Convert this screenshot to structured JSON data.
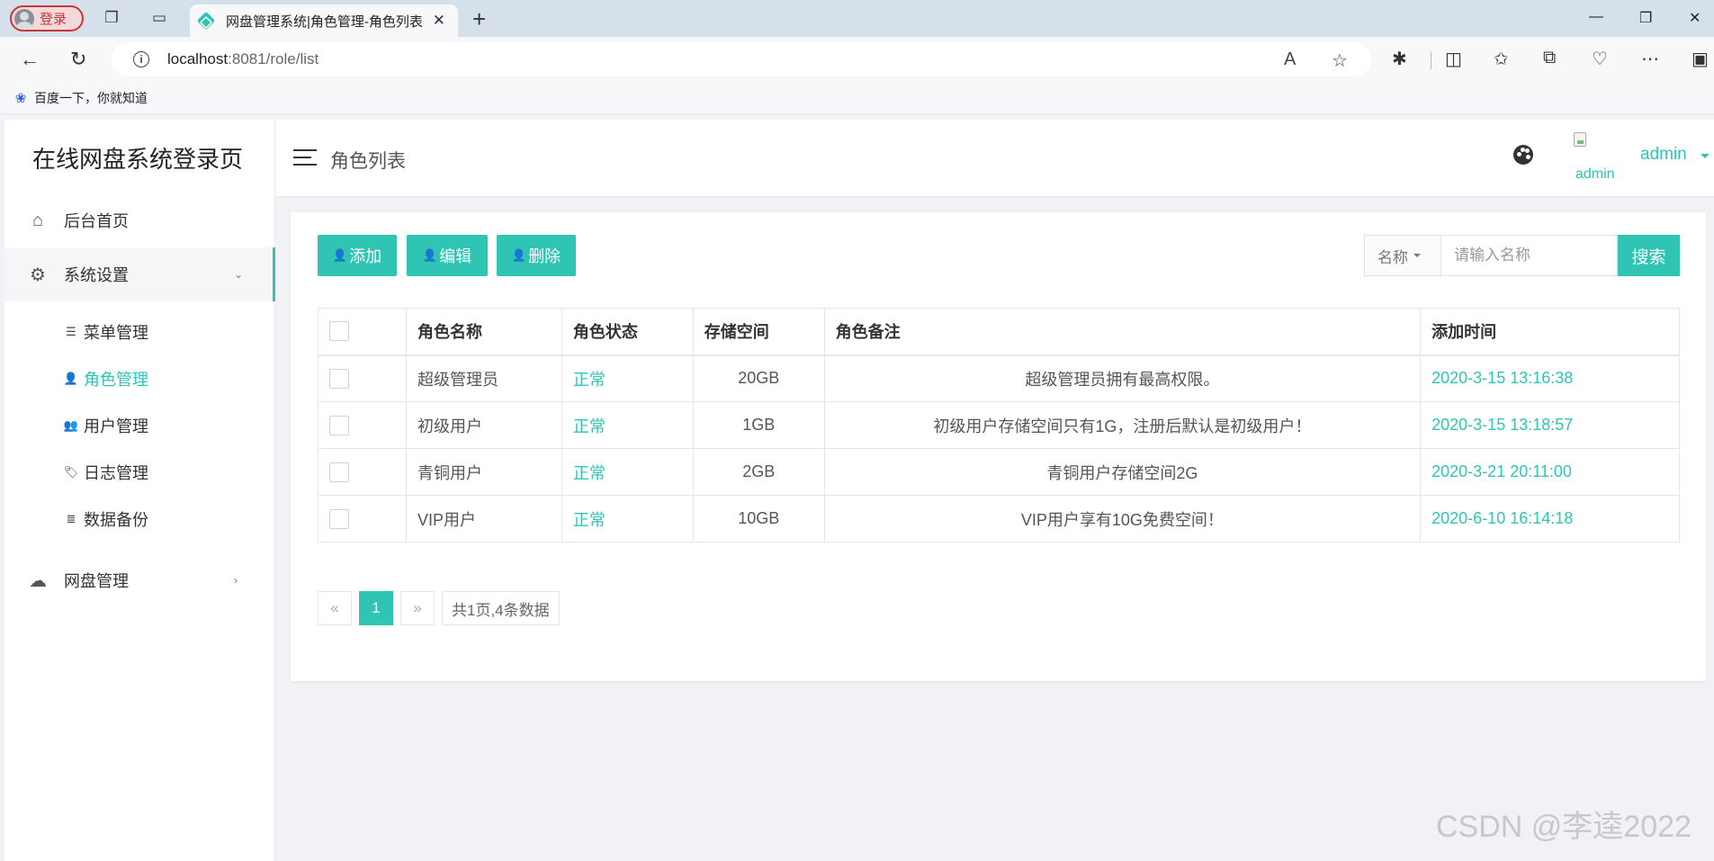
{
  "browser": {
    "profile_label": "登录",
    "tab_title": "网盘管理系统|角色管理-角色列表",
    "url_host": "localhost",
    "url_rest": ":8081/role/list",
    "favorite_label": "百度一下，你就知道"
  },
  "sidebar": {
    "title": "在线网盘系统登录页",
    "items": [
      {
        "label": "后台首页",
        "icon": "home-icon"
      },
      {
        "label": "系统设置",
        "icon": "gear-icon"
      },
      {
        "label": "网盘管理",
        "icon": "cloud-icon"
      }
    ],
    "subitems": [
      {
        "label": "菜单管理",
        "icon": "list-icon"
      },
      {
        "label": "角色管理",
        "icon": "user-gear-icon"
      },
      {
        "label": "用户管理",
        "icon": "users-icon"
      },
      {
        "label": "日志管理",
        "icon": "tags-icon"
      },
      {
        "label": "数据备份",
        "icon": "database-icon"
      }
    ]
  },
  "header": {
    "page_title": "角色列表",
    "avatar_alt": "admin",
    "user_name": "admin"
  },
  "toolbar": {
    "add_label": "添加",
    "edit_label": "编辑",
    "delete_label": "删除"
  },
  "search": {
    "field_label": "名称",
    "placeholder": "请输入名称",
    "button_label": "搜索"
  },
  "table": {
    "headers": [
      "角色名称",
      "角色状态",
      "存储空间",
      "角色备注",
      "添加时间"
    ],
    "rows": [
      {
        "name": "超级管理员",
        "status": "正常",
        "space": "20GB",
        "remark": "超级管理员拥有最高权限。",
        "time": "2020-3-15 13:16:38"
      },
      {
        "name": "初级用户",
        "status": "正常",
        "space": "1GB",
        "remark": "初级用户存储空间只有1G，注册后默认是初级用户！",
        "time": "2020-3-15 13:18:57"
      },
      {
        "name": "青铜用户",
        "status": "正常",
        "space": "2GB",
        "remark": "青铜用户存储空间2G",
        "time": "2020-3-21 20:11:00"
      },
      {
        "name": "VIP用户",
        "status": "正常",
        "space": "10GB",
        "remark": "VIP用户享有10G免费空间！",
        "time": "2020-6-10 16:14:18"
      }
    ]
  },
  "pagination": {
    "prev": "«",
    "current": "1",
    "next": "»",
    "info": "共1页,4条数据"
  },
  "watermark": "CSDN @李逵2022",
  "colors": {
    "accent": "#2fc4b4"
  }
}
